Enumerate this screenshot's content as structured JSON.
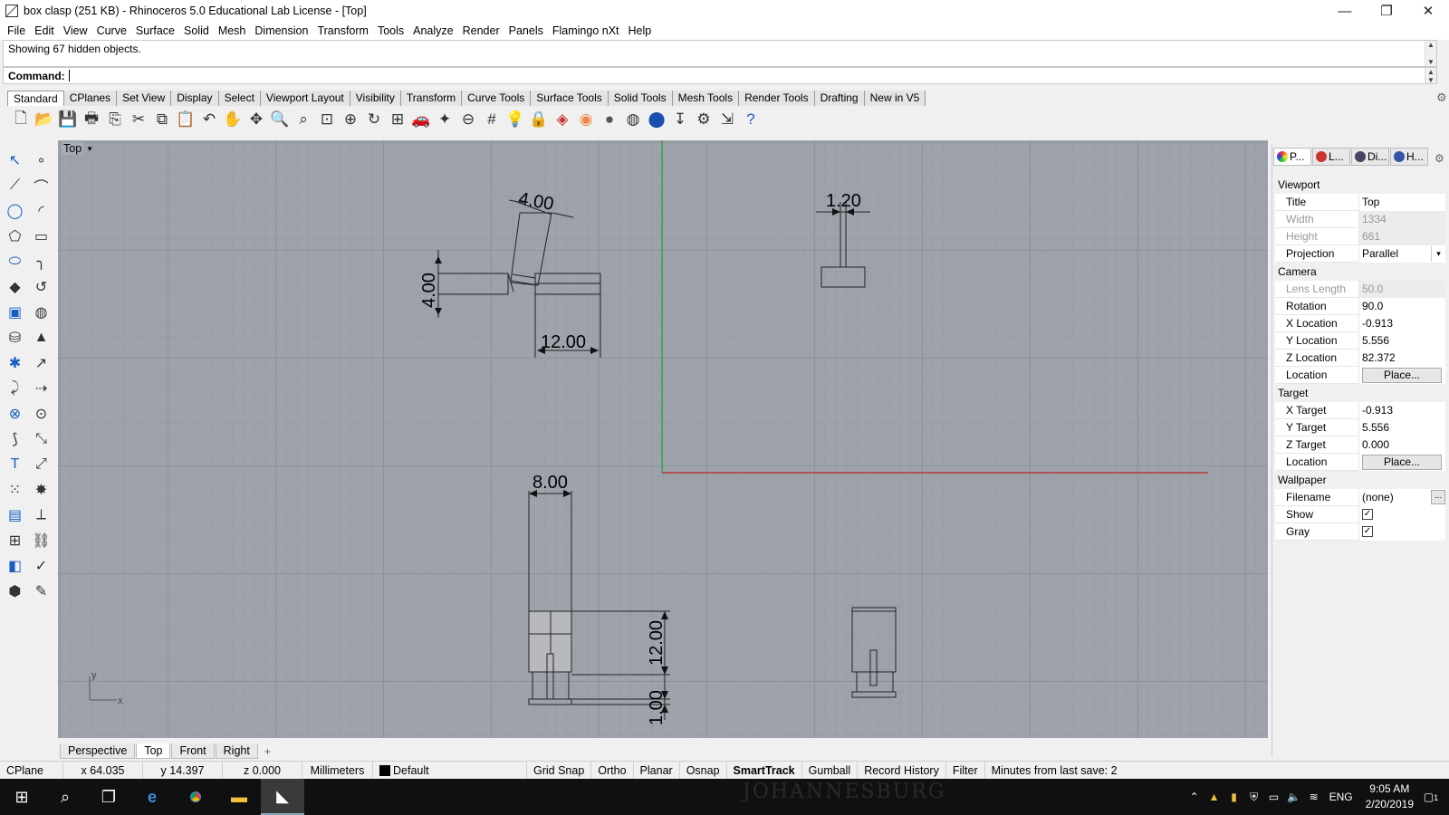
{
  "window": {
    "title": "box clasp (251 KB) - Rhinoceros 5.0 Educational Lab License - [Top]",
    "minimize": "—",
    "maximize": "❐",
    "close": "✕"
  },
  "menu": [
    "File",
    "Edit",
    "View",
    "Curve",
    "Surface",
    "Solid",
    "Mesh",
    "Dimension",
    "Transform",
    "Tools",
    "Analyze",
    "Render",
    "Panels",
    "Flamingo nXt",
    "Help"
  ],
  "command": {
    "history": "Showing 67 hidden objects.",
    "prompt": "Command:"
  },
  "toolbar_tabs": [
    "Standard",
    "CPlanes",
    "Set View",
    "Display",
    "Select",
    "Viewport Layout",
    "Visibility",
    "Transform",
    "Curve Tools",
    "Surface Tools",
    "Solid Tools",
    "Mesh Tools",
    "Render Tools",
    "Drafting",
    "New in V5"
  ],
  "toolbar_icons": [
    "new-file-icon",
    "open-file-icon",
    "save-icon",
    "print-icon",
    "import-icon",
    "cut-icon",
    "copy-icon",
    "paste-icon",
    "undo-icon",
    "pan-icon",
    "rotate-view-icon",
    "zoom-dynamic-icon",
    "zoom-window-icon",
    "zoom-extents-icon",
    "zoom-selected-icon",
    "rotate-icon",
    "four-viewports-icon",
    "car-icon",
    "render-options-icon",
    "osnap-icon",
    "grid-icon",
    "light-icon",
    "lock-icon",
    "layer-icon",
    "color-wheel-icon",
    "material-icon",
    "render-preview-icon",
    "render-icon",
    "dimension-icon",
    "settings-icon",
    "hide-icon",
    "help-icon"
  ],
  "left_tool_icons": [
    "select-icon",
    "point-icon",
    "polyline-icon",
    "curve-icon",
    "circle-icon",
    "arc-icon",
    "polygon-icon",
    "rectangle-icon",
    "ellipse-icon",
    "fillet-icon",
    "surface-icon",
    "revolve-icon",
    "box-icon",
    "sphere-icon",
    "cylinder-icon",
    "extrude-icon",
    "gumball-icon",
    "arrow-icon",
    "move-icon",
    "align-icon",
    "boolean-icon",
    "group-icon",
    "curve-edit-icon",
    "trim-icon",
    "text-icon",
    "scale-icon",
    "array-icon",
    "explode-icon",
    "render-box-icon",
    "dimension-icon",
    "grid-array-icon",
    "join-icon",
    "mesh-icon",
    "check-icon",
    "solid-edit-icon",
    "pencil-icon"
  ],
  "viewport": {
    "name": "Top",
    "dims": {
      "top_angle": "4.00",
      "top_vertical": "4.00",
      "top_horizontal": "12.00",
      "right_width": "1.20",
      "bottom_width": "8.00",
      "bottom_height1": "12.00",
      "bottom_height2": "1.00"
    },
    "axis_x": "x",
    "axis_y": "y"
  },
  "viewport_tabs": [
    "Perspective",
    "Top",
    "Front",
    "Right",
    "+"
  ],
  "properties": {
    "tabs": [
      "P...",
      "L...",
      "Di...",
      "H..."
    ],
    "viewport_section": "Viewport",
    "viewport_rows": [
      {
        "label": "Title",
        "value": "Top",
        "disabled": false
      },
      {
        "label": "Width",
        "value": "1334",
        "disabled": true
      },
      {
        "label": "Height",
        "value": "661",
        "disabled": true
      },
      {
        "label": "Projection",
        "value": "Parallel",
        "disabled": false
      }
    ],
    "camera_section": "Camera",
    "camera_rows": [
      {
        "label": "Lens Length",
        "value": "50.0",
        "disabled": true
      },
      {
        "label": "Rotation",
        "value": "90.0",
        "disabled": false
      },
      {
        "label": "X Location",
        "value": "-0.913",
        "disabled": false
      },
      {
        "label": "Y Location",
        "value": "5.556",
        "disabled": false
      },
      {
        "label": "Z Location",
        "value": "82.372",
        "disabled": false
      }
    ],
    "location_label": "Location",
    "place_button": "Place...",
    "target_section": "Target",
    "target_rows": [
      {
        "label": "X Target",
        "value": "-0.913",
        "disabled": false
      },
      {
        "label": "Y Target",
        "value": "5.556",
        "disabled": false
      },
      {
        "label": "Z Target",
        "value": "0.000",
        "disabled": false
      }
    ],
    "wallpaper_section": "Wallpaper",
    "filename_label": "Filename",
    "filename_value": "(none)",
    "browse_button": "...",
    "show_label": "Show",
    "gray_label": "Gray",
    "check": "✓"
  },
  "status": {
    "cplane": "CPlane",
    "x": "x 64.035",
    "y": "y 14.397",
    "z": "z 0.000",
    "units": "Millimeters",
    "layer": "Default",
    "grid_snap": "Grid Snap",
    "ortho": "Ortho",
    "planar": "Planar",
    "osnap": "Osnap",
    "smarttrack": "SmartTrack",
    "gumball": "Gumball",
    "record_history": "Record History",
    "filter": "Filter",
    "minutes": "Minutes from last save: 2"
  },
  "taskbar": {
    "watermark": "JOHANNESBURG",
    "time": "9:05 AM",
    "date": "2/20/2019",
    "lang": "ENG",
    "notif": "1"
  },
  "colors": {
    "viewport_bg": "#9ea3ab",
    "x_axis": "#b33a3a",
    "y_axis": "#3aa04a"
  }
}
